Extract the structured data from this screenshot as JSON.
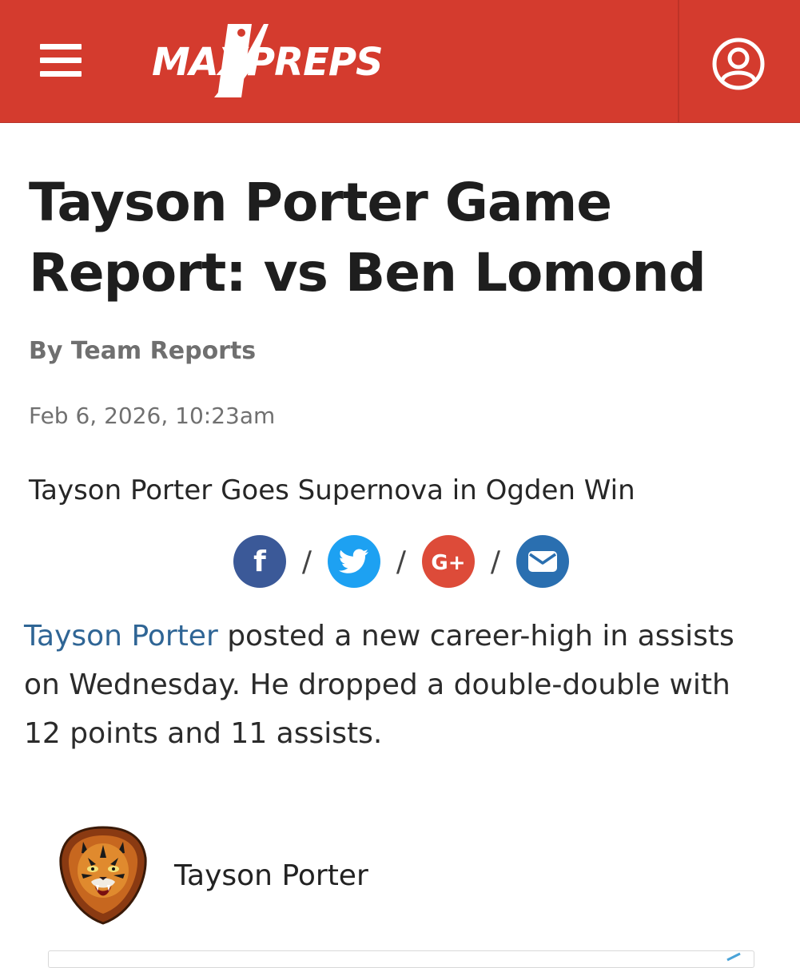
{
  "header": {
    "brand": "MAXPREPS",
    "colors": {
      "bar": "#d43b2e",
      "text": "#ffffff"
    },
    "icons": {
      "menu": "hamburger-menu-icon",
      "account": "user-account-icon"
    }
  },
  "article": {
    "title": "Tayson Porter Game Report: vs Ben Lomond",
    "byline": "By Team Reports",
    "date": "Feb 6, 2026, 10:23am",
    "subhead": "Tayson Porter Goes Supernova in Ogden Win",
    "share": {
      "separator": "/",
      "buttons": [
        {
          "name": "facebook",
          "glyph": "f",
          "color": "#3b5998",
          "icon": "facebook-icon"
        },
        {
          "name": "twitter",
          "color": "#1da1f2",
          "icon": "twitter-bird-icon"
        },
        {
          "name": "google-plus",
          "glyph": "G+",
          "color": "#dd4b39",
          "icon": "google-plus-icon"
        },
        {
          "name": "email",
          "color": "#2a6fb0",
          "icon": "envelope-icon"
        }
      ]
    },
    "body": {
      "player_link": "Tayson Porter",
      "text": " posted a new career-high in assists on Wednesday. He dropped a double-double with 12 points and 11 assists."
    },
    "player_card": {
      "name": "Tayson Porter",
      "avatar": "tiger-mascot-logo"
    }
  }
}
